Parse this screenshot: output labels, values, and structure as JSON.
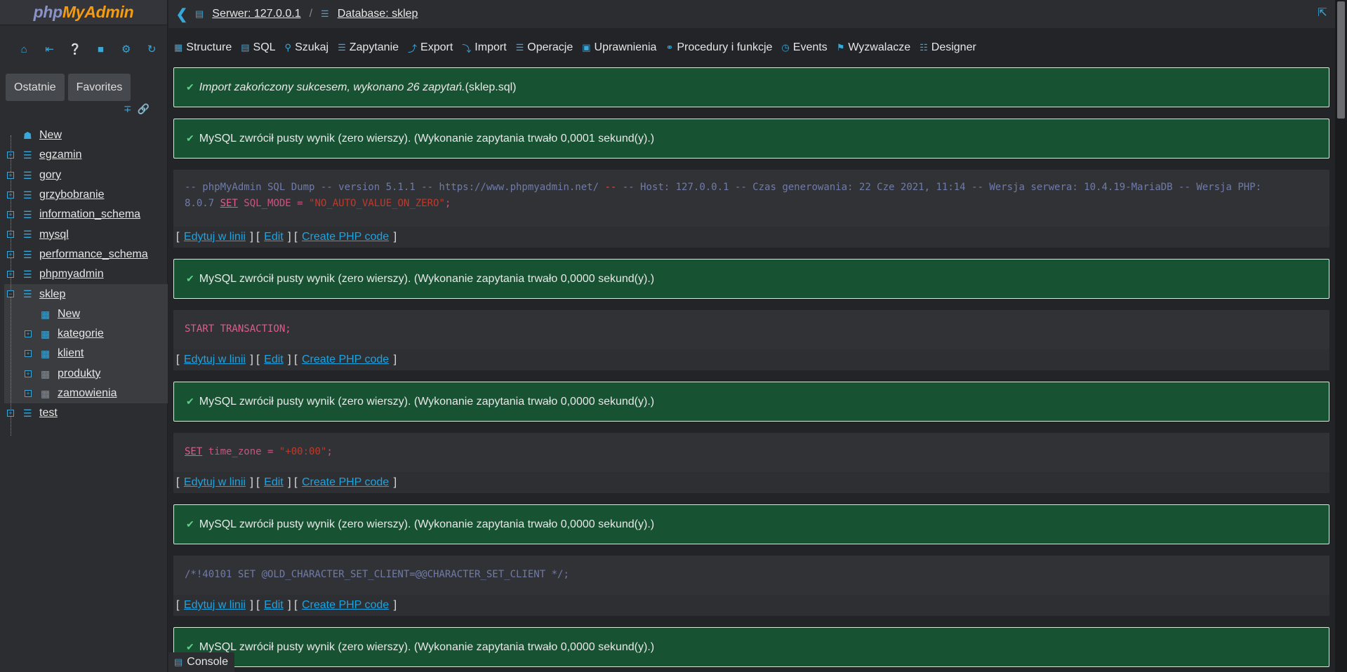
{
  "logo": {
    "php": "php",
    "my": "MyAdmin"
  },
  "sidebar": {
    "nav_icons": [
      "home-icon",
      "logout-icon",
      "help-icon",
      "docs-icon",
      "settings-icon",
      "reload-icon"
    ],
    "tabs": {
      "recent": "Ostatnie",
      "favorites": "Favorites"
    },
    "tree": {
      "new": "New",
      "dbs": [
        "egzamin",
        "gory",
        "grzybobranie",
        "information_schema",
        "mysql",
        "performance_schema",
        "phpmyadmin",
        "sklep",
        "test"
      ],
      "sklep_children": [
        "New",
        "kategorie",
        "klient",
        "produkty",
        "zamowienia"
      ]
    }
  },
  "breadcrumb": {
    "server": "Serwer: 127.0.0.1",
    "sep": "/",
    "database": "Database: sklep"
  },
  "menu": [
    "Structure",
    "SQL",
    "Szukaj",
    "Zapytanie",
    "Export",
    "Import",
    "Operacje",
    "Uprawnienia",
    "Procedury i funkcje",
    "Events",
    "Wyzwalacze",
    "Designer"
  ],
  "messages": {
    "import_ok_em": "Import zakończony sukcesem, wykonano 26 zapytań.",
    "import_ok_file": " (sklep.sql)",
    "empty_1": "MySQL zwrócił pusty wynik (zero wierszy). (Wykonanie zapytania trwało 0,0001 sekund(y).)",
    "empty_0": "MySQL zwrócił pusty wynik (zero wierszy). (Wykonanie zapytania trwało 0,0000 sekund(y).)"
  },
  "sql": {
    "dump_comment": "-- phpMyAdmin SQL Dump -- version 5.1.1 -- https://www.phpmyadmin.net/ ",
    "dump_dash": "--",
    "dump_comment2": " -- Host: 127.0.0.1 -- Czas generowania: 22 Cze 2021, 11:14 -- Wersja serwera: 10.4.19-MariaDB -- Wersja PHP:",
    "dump_php": "8.0.7 ",
    "set": "SET",
    "sql_mode": " SQL_MODE = ",
    "sql_mode_val": "\"NO_AUTO_VALUE_ON_ZERO\"",
    "semi": ";",
    "start": "START TRANSACTION;",
    "tz": " time_zone = ",
    "tz_val": "\"+00:00\"",
    "charset": "/*!40101 SET @OLD_CHARACTER_SET_CLIENT=@@CHARACTER_SET_CLIENT */;"
  },
  "links": {
    "inline": "Edytuj w linii",
    "edit": "Edit",
    "php": "Create PHP code"
  },
  "console": "Console"
}
